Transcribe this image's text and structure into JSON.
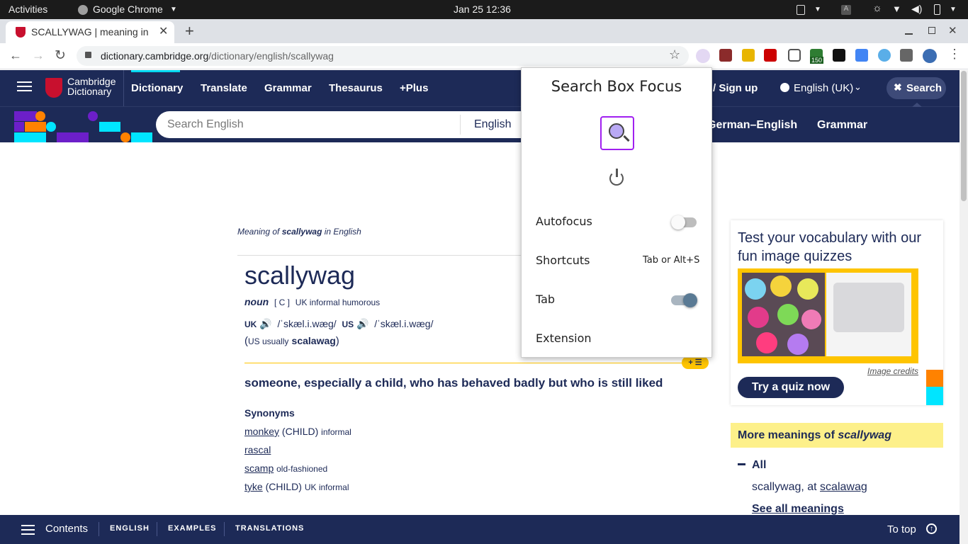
{
  "os_bar": {
    "activities": "Activities",
    "app": "Google Chrome",
    "clock": "Jan 25  12:36"
  },
  "browser": {
    "tab_title": "SCALLYWAG | meaning in",
    "url_host": "dictionary.cambridge.org",
    "url_path": "/dictionary/english/scallywag",
    "ext_badge": "150"
  },
  "site": {
    "logo_line1": "Cambridge",
    "logo_line2": "Dictionary",
    "nav": [
      "Dictionary",
      "Translate",
      "Grammar",
      "Thesaurus",
      "+Plus"
    ],
    "signup": "/ Sign up",
    "language": "English (UK)",
    "search_btn": "Search",
    "search_placeholder": "Search English",
    "search_lang": "English",
    "nav2": [
      "German–English",
      "Grammar"
    ]
  },
  "entry": {
    "meaning_prefix": "Meaning of ",
    "meaning_word": "scallywag",
    "meaning_suffix": " in English",
    "headword": "scallywag",
    "pos": "noun",
    "gram": "[ C ]",
    "labels": "UK informal humorous",
    "uk": "UK",
    "uk_ipa": "/ˈskæl.i.wæɡ/",
    "us": "US",
    "us_ipa": "/ˈskæl.i.wæɡ/",
    "alt_open": "(",
    "alt_us": "US usually",
    "alt_word": "scalawag",
    "alt_close": ")",
    "definition": "someone, especially a child, who has behaved badly but who is still liked",
    "synonyms_title": "Synonyms",
    "synonyms": [
      {
        "word": "monkey",
        "note": " (CHILD) ",
        "label": "informal"
      },
      {
        "word": "rascal",
        "note": "",
        "label": ""
      },
      {
        "word": "scamp",
        "note": " ",
        "label": "old-fashioned"
      },
      {
        "word": "tyke",
        "note": " (CHILD) ",
        "label": "UK informal"
      }
    ]
  },
  "sidebar": {
    "quiz_title": "Test your vocabulary with our fun image quizzes",
    "image_credits": "Image credits",
    "quiz_button": "Try a quiz now",
    "more_prefix": "More meanings of ",
    "more_word": "scallywag",
    "all_label": "All",
    "item_text": "scallywag, at ",
    "item_link": "scalawag",
    "see_all": "See all meanings"
  },
  "popup": {
    "title": "Search Box Focus",
    "autofocus_label": "Autofocus",
    "autofocus_on": false,
    "shortcuts_label": "Shortcuts",
    "shortcuts_value": "Tab or Alt+S",
    "tab_label": "Tab",
    "tab_on": true,
    "extension_label": "Extension"
  },
  "bottom_bar": {
    "contents": "Contents",
    "links": [
      "ENGLISH",
      "EXAMPLES",
      "TRANSLATIONS"
    ],
    "to_top": "To top"
  },
  "colors": {
    "brand_navy": "#1d2a57",
    "accent_yellow": "#fec400",
    "popup_purple": "#a020f0",
    "toggle_on": "#5a7a94"
  }
}
